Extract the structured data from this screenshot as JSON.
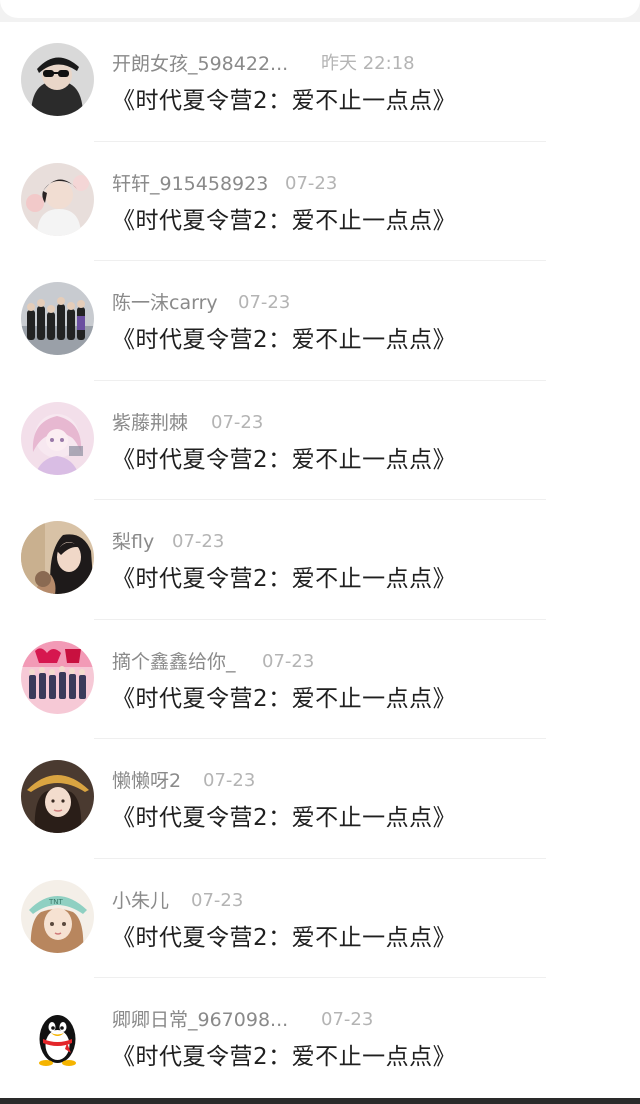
{
  "items": [
    {
      "name": "开朗女孩_598422...",
      "time": "昨天 22:18",
      "title": "《时代夏令营2：爱不止一点点》",
      "avatar": "avatar-girl-sunglasses-icon"
    },
    {
      "name": "轩轩_915458923",
      "time": "07-23",
      "title": "《时代夏令营2：爱不止一点点》",
      "avatar": "avatar-boy-flowers-icon"
    },
    {
      "name": "陈一沫carry",
      "time": "07-23",
      "title": "《时代夏令营2：爱不止一点点》",
      "avatar": "avatar-group-photo-icon"
    },
    {
      "name": "紫藤荆棘",
      "time": "07-23",
      "title": "《时代夏令营2：爱不止一点点》",
      "avatar": "avatar-pink-anime-icon"
    },
    {
      "name": "梨fly",
      "time": "07-23",
      "title": "《时代夏令营2：爱不止一点点》",
      "avatar": "avatar-girl-long-hair-icon"
    },
    {
      "name": "摘个鑫鑫给你_",
      "time": "07-23",
      "title": "《时代夏令营2：爱不止一点点》",
      "avatar": "avatar-pink-poster-icon"
    },
    {
      "name": "懒懒呀2",
      "time": "07-23",
      "title": "《时代夏令营2：爱不止一点点》",
      "avatar": "avatar-girl-hat-icon"
    },
    {
      "name": "小朱儿",
      "time": "07-23",
      "title": "《时代夏令营2：爱不止一点点》",
      "avatar": "avatar-cartoon-girl-icon"
    },
    {
      "name": "卿卿日常_967098...",
      "time": "07-23",
      "title": "《时代夏令营2：爱不止一点点》",
      "avatar": "qq-penguin-icon"
    }
  ],
  "colors": {
    "name": "#8a8a8a",
    "time": "#b4b4b4",
    "title": "#1f1f1f",
    "divider": "#efefef"
  }
}
